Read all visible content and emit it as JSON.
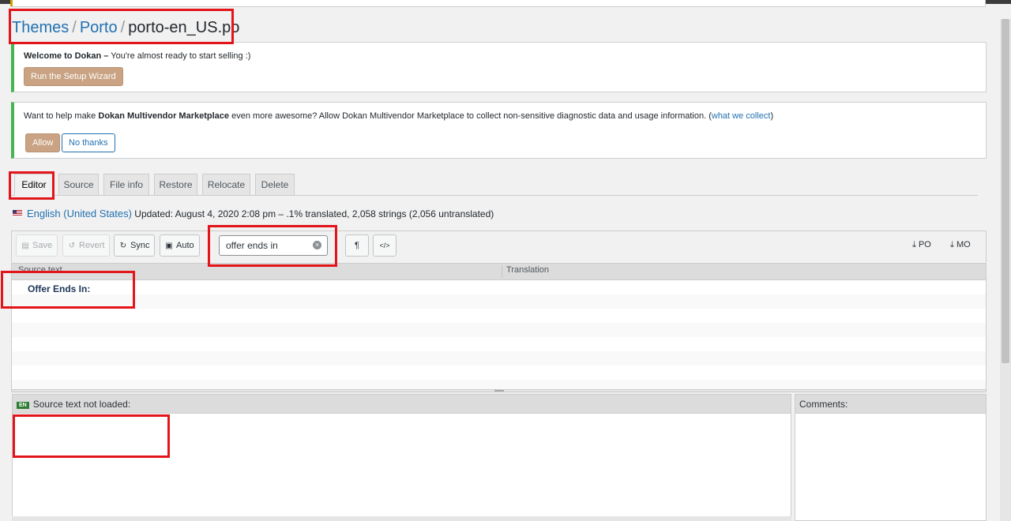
{
  "breadcrumb": {
    "themes": "Themes",
    "separator1": "/",
    "porto": "Porto",
    "separator2": "/",
    "file": "porto-en_US.po"
  },
  "notice_welcome": {
    "title": "Welcome to Dokan –",
    "text": "You're almost ready to start selling :)",
    "button": "Run the Setup Wizard"
  },
  "notice_tracking": {
    "text_before": "Want to help make",
    "product": "Dokan Multivendor Marketplace",
    "text_after": "even more awesome? Allow Dokan Multivendor Marketplace to collect non-sensitive diagnostic data and usage information. (",
    "link": "what we collect",
    "close_paren": ")",
    "allow": "Allow",
    "no_thanks": "No thanks"
  },
  "tabs": [
    "Editor",
    "Source",
    "File info",
    "Restore",
    "Relocate",
    "Delete"
  ],
  "locale": {
    "language": "English (United States)",
    "status": "Updated: August 4, 2020 2:08 pm – .1% translated, 2,058 strings (2,056 untranslated)"
  },
  "toolbar": {
    "save": "Save",
    "revert": "Revert",
    "sync": "Sync",
    "auto": "Auto",
    "search_value": "offer ends in",
    "pilcrow": "¶",
    "code": "</>",
    "po": "PO",
    "mo": "MO"
  },
  "grid": {
    "col_source": "Source text",
    "col_translation": "Translation",
    "rows": [
      "Offer Ends In:"
    ]
  },
  "source_panel": {
    "badge": "EN",
    "label": "Source text not loaded:"
  },
  "comments_panel": {
    "label": "Comments:"
  },
  "icons": {
    "save": "floppy-icon",
    "revert": "undo-icon",
    "sync": "sync-icon",
    "auto": "robot-icon",
    "clear": "clear-icon",
    "download": "download-icon",
    "flag": "us-flag-icon"
  }
}
